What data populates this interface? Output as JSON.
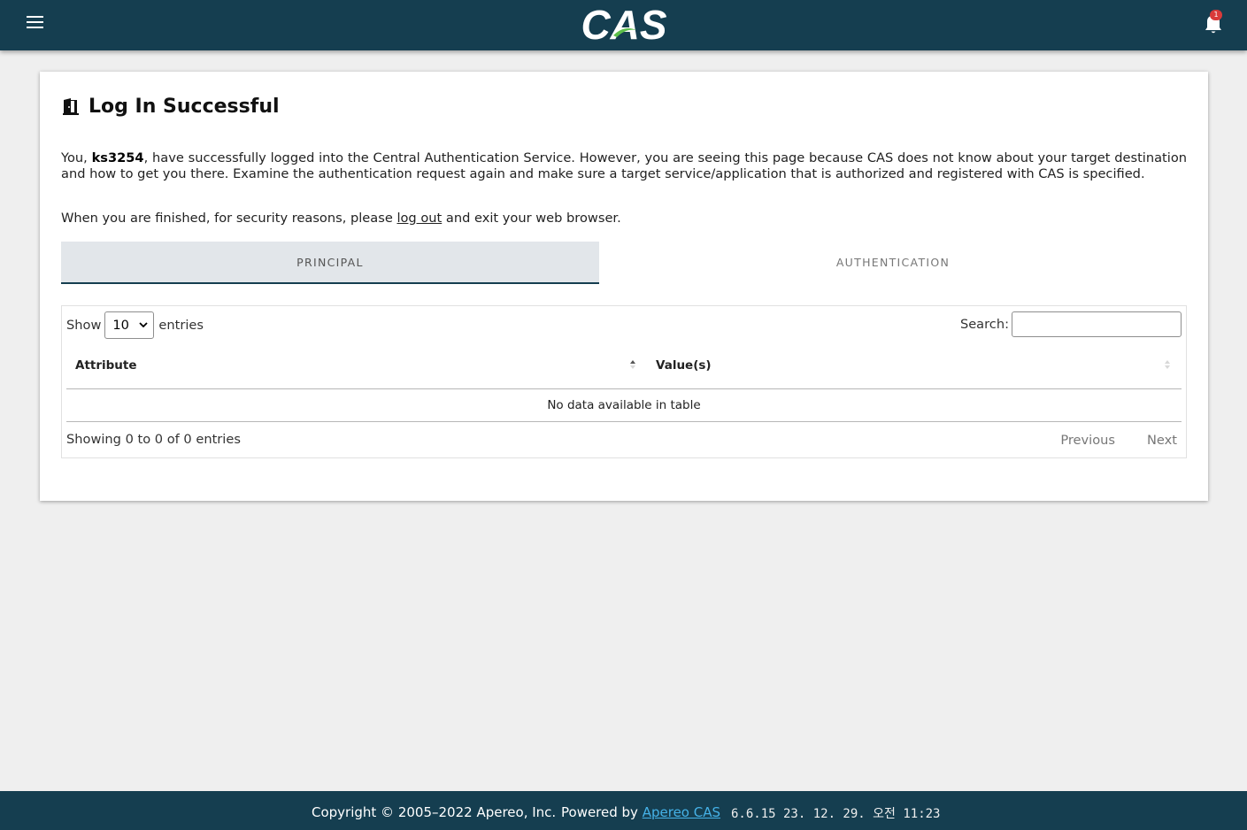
{
  "header": {
    "logo_text": "CAS",
    "notification_count": "1"
  },
  "card": {
    "title": "Log In Successful",
    "para1_prefix": "You, ",
    "username": "ks3254",
    "para1_suffix": ", have successfully logged into the Central Authentication Service. However, you are seeing this page because CAS does not know about your target destination and how to get you there. Examine the authentication request again and make sure a target service/application that is authorized and registered with CAS is specified.",
    "para2_prefix": "When you are finished, for security reasons, please ",
    "logout_link": "log out",
    "para2_suffix": " and exit your web browser."
  },
  "tabs": [
    {
      "label": "PRINCIPAL",
      "active": true
    },
    {
      "label": "AUTHENTICATION",
      "active": false
    }
  ],
  "table": {
    "show_label": "Show",
    "entries_label": "entries",
    "page_length": "10",
    "search_label": "Search:",
    "search_value": "",
    "columns": [
      "Attribute",
      "Value(s)"
    ],
    "empty_message": "No data available in table",
    "info": "Showing 0 to 0 of 0 entries",
    "previous_label": "Previous",
    "next_label": "Next"
  },
  "footer": {
    "copyright": "Copyright © 2005–2022 Apereo, Inc.",
    "powered_prefix": "Powered by ",
    "powered_link": "Apereo CAS",
    "version": "6.6.15 23. 12. 29. 오전 11:23"
  },
  "colors": {
    "header_bg": "#153e50",
    "active_tab_bg": "#e2e6ea",
    "link_blue": "#45b2e8"
  }
}
